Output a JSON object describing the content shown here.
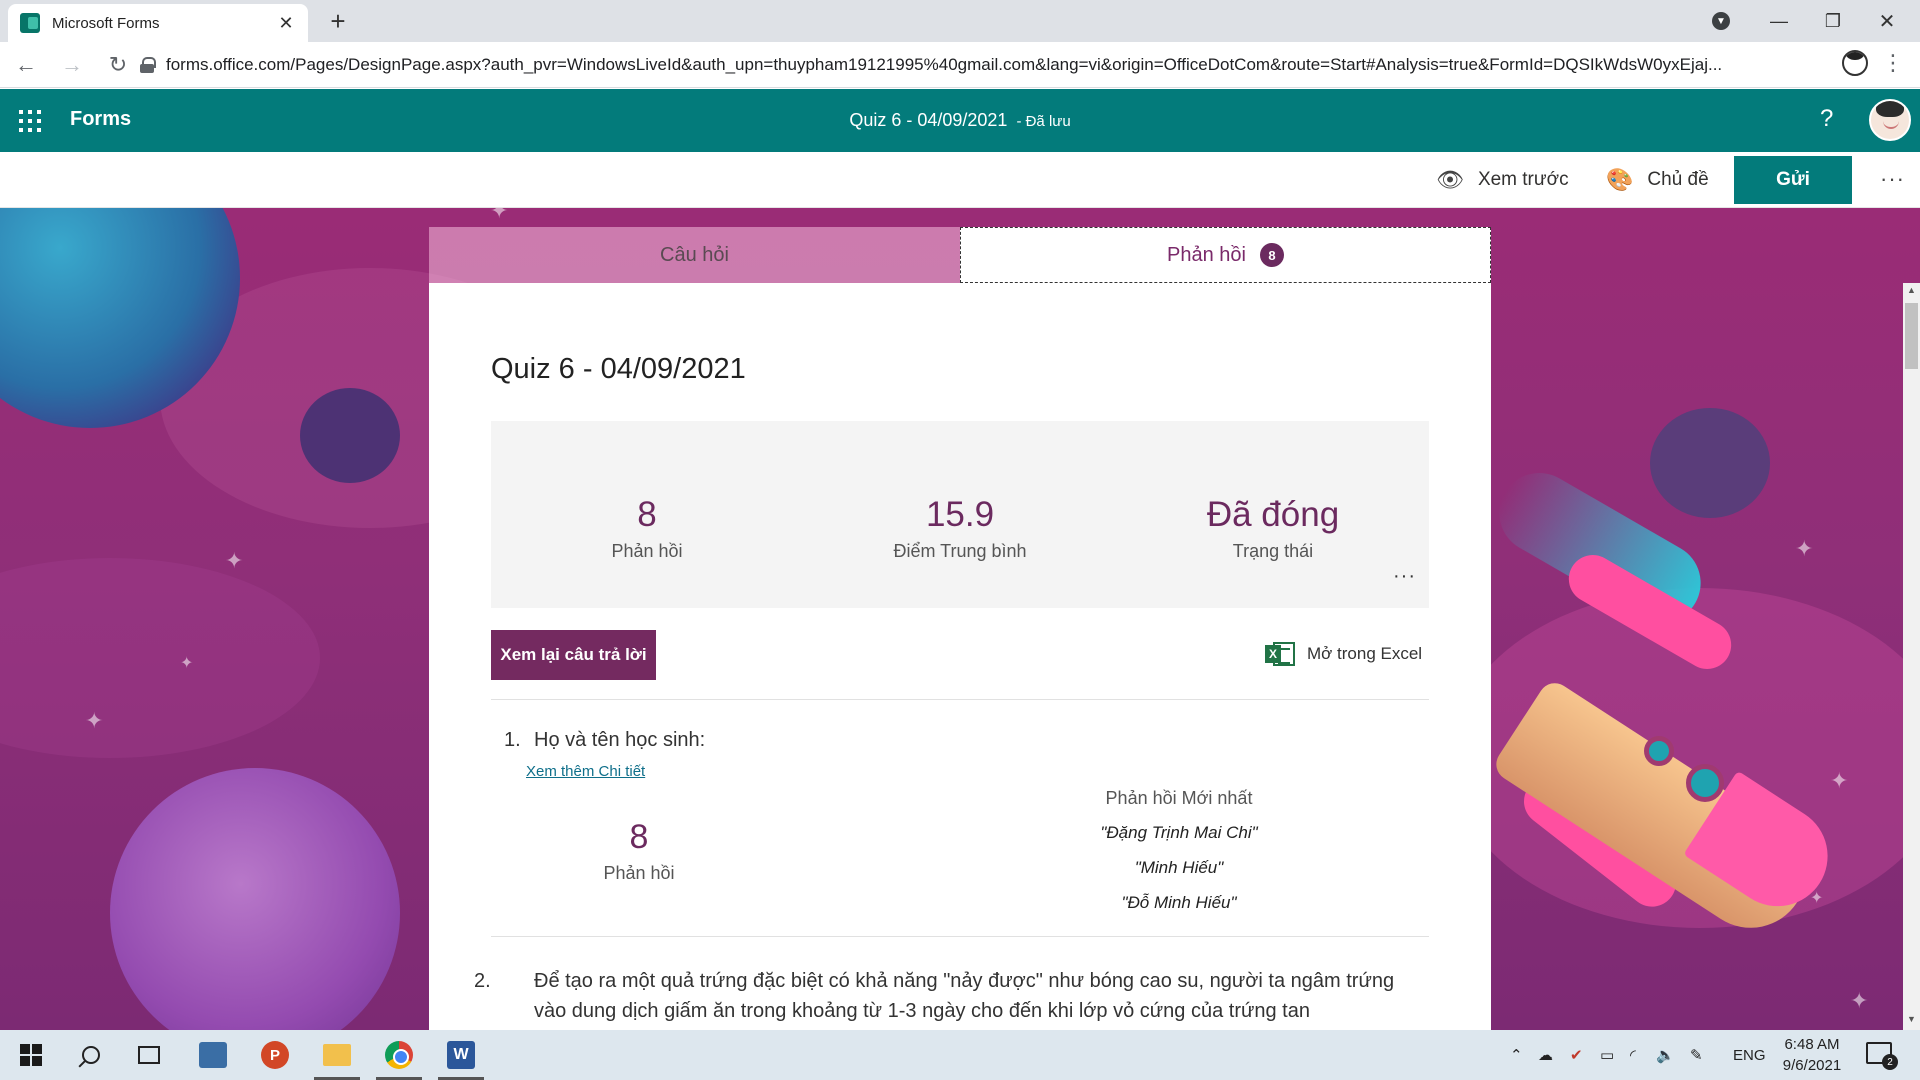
{
  "browser": {
    "tab_title": "Microsoft Forms",
    "tab_close": "✕",
    "new_tab": "+",
    "url": "forms.office.com/Pages/DesignPage.aspx?auth_pvr=WindowsLiveId&auth_upn=thuypham19121995%40gmail.com&lang=vi&origin=OfficeDotCom&route=Start#Analysis=true&FormId=DQSIkWdsW0yxEjaj...",
    "minimize": "—",
    "maximize": "❐",
    "close": "✕"
  },
  "appbar": {
    "brand": "Forms",
    "doc_title": "Quiz 6 - 04/09/2021",
    "saved_status": "- Đã lưu",
    "help": "?"
  },
  "commands": {
    "preview_label": "Xem trước",
    "theme_label": "Chủ đề",
    "send_label": "Gửi",
    "more": "···"
  },
  "tabs": {
    "questions_label": "Câu hỏi",
    "responses_label": "Phản hồi",
    "responses_badge": "8"
  },
  "form": {
    "title": "Quiz 6 - 04/09/2021",
    "summary": {
      "responses_value": "8",
      "responses_label": "Phản hồi",
      "avg_score_value": "15.9",
      "avg_score_label": "Điểm Trung bình",
      "status_value": "Đã đóng",
      "status_label": "Trạng thái",
      "more": "···"
    },
    "review_button": "Xem lại câu trả lời",
    "open_excel": "Mở trong Excel",
    "questions": [
      {
        "number": "1.",
        "text": "Họ và tên học sinh:",
        "details_link": "Xem thêm Chi tiết",
        "count_value": "8",
        "count_label": "Phản hồi",
        "latest_header": "Phản hồi Mới nhất",
        "latest": [
          "\"Đặng Trịnh Mai Chi\"",
          "\"Minh Hiếu\"",
          "\"Đỗ Minh Hiếu\""
        ]
      },
      {
        "number": "2.",
        "text": "Để tạo ra một quả trứng đặc biệt có khả năng \"nảy được\" như bóng cao su, người ta ngâm trứng vào dung dịch giấm ăn trong khoảng từ 1-3 ngày cho đến khi lớp vỏ cứng của trứng tan"
      }
    ]
  },
  "taskbar": {
    "language": "ENG",
    "time": "6:48 AM",
    "date": "9/6/2021",
    "notifications": "2"
  },
  "colors": {
    "app_teal": "#037b7b",
    "accent_purple": "#742a60",
    "metric_purple": "#6b2a5f"
  }
}
